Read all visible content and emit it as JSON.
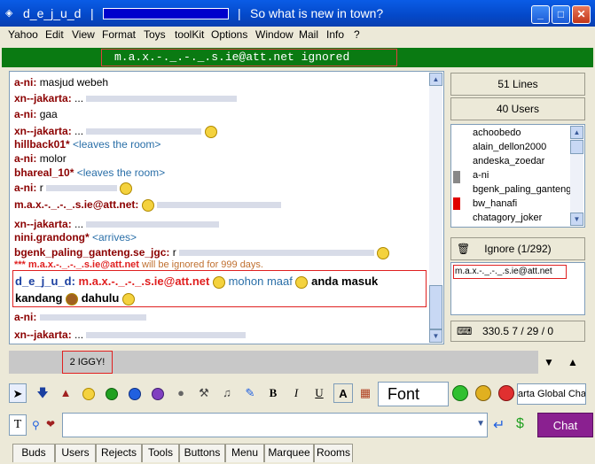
{
  "window": {
    "title": "d_e_j_u_d",
    "subtitle": "So what is new in town?",
    "sep1": "|",
    "sep2": "|"
  },
  "menu": [
    "Yahoo",
    "Edit",
    "View",
    "Format",
    "Toys",
    "toolKit",
    "Options",
    "Window",
    "Mail",
    "Info",
    "?"
  ],
  "marquee": {
    "text": "m.a.x.-._.-._.s.ie@att.net ignored"
  },
  "chat": {
    "lines": [
      {
        "nick": "a-ni:",
        "text": "masjud webeh"
      },
      {
        "nick": "xn--jakarta:",
        "text": "..."
      },
      {
        "nick": "a-ni:",
        "text": "gaa"
      },
      {
        "nick": "xn--jakarta:",
        "text": "..."
      },
      {
        "nick": "hillback01*",
        "text": "<leaves the room>"
      },
      {
        "nick": "a-ni:",
        "text": "molor"
      },
      {
        "nick": "bhareal_10*",
        "text": "<leaves the room>"
      },
      {
        "nick": "a-ni:",
        "text": "r"
      },
      {
        "nick": "m.a.x.-._.-._.s.ie@att.net:",
        "text": ""
      },
      {
        "nick": "xn--jakarta:",
        "text": "..."
      },
      {
        "nick": "nini.grandong*",
        "text": "<arrives>"
      },
      {
        "nick": "bgenk_paling_ganteng.se_jgc:",
        "text": "r"
      },
      {
        "nick": "*** m.a.x.-._.-._.s.ie@att.net",
        "text": "will be ignored for 999 days."
      }
    ],
    "highlight": {
      "nick": "d_e_j_u_d:",
      "target": "m.a.x.-._.-._.s.ie@att.net",
      "t1": "mohon maaf",
      "t2": "anda masuk",
      "t3": "kandang",
      "t4": "dahulu"
    },
    "after": [
      {
        "nick": "a-ni:",
        "text": ""
      },
      {
        "nick": "xn--jakarta:",
        "text": "..."
      }
    ]
  },
  "side": {
    "lines": "51 Lines",
    "users": "40 Users",
    "ignore": "Ignore (1/292)",
    "ignored_item": "m.a.x.-._.-._.s.ie@att.net",
    "stats": "330.5  7 / 29 / 0"
  },
  "userlist": [
    "achoobedo",
    "alain_dellon2000",
    "andeska_zoedar",
    "a-ni",
    "bgenk_paling_ganteng.",
    "bw_hanafi",
    "chatagory_joker"
  ],
  "tabs": {
    "t2": "2 IGGY!"
  },
  "format": {
    "font": "Font",
    "room": "arta Global Cha",
    "bold": "B",
    "italic": "I",
    "underline": "U"
  },
  "input": {
    "t_label": "T",
    "chat": "Chat"
  },
  "bottom_tabs": [
    "Buds",
    "Users",
    "Rejects",
    "Tools",
    "Buttons",
    "Menu",
    "Marquee",
    "Rooms"
  ],
  "colors": {
    "accent": "#8a2090",
    "marquee_bg": "#0a7a12",
    "nick": "#8b0000"
  }
}
